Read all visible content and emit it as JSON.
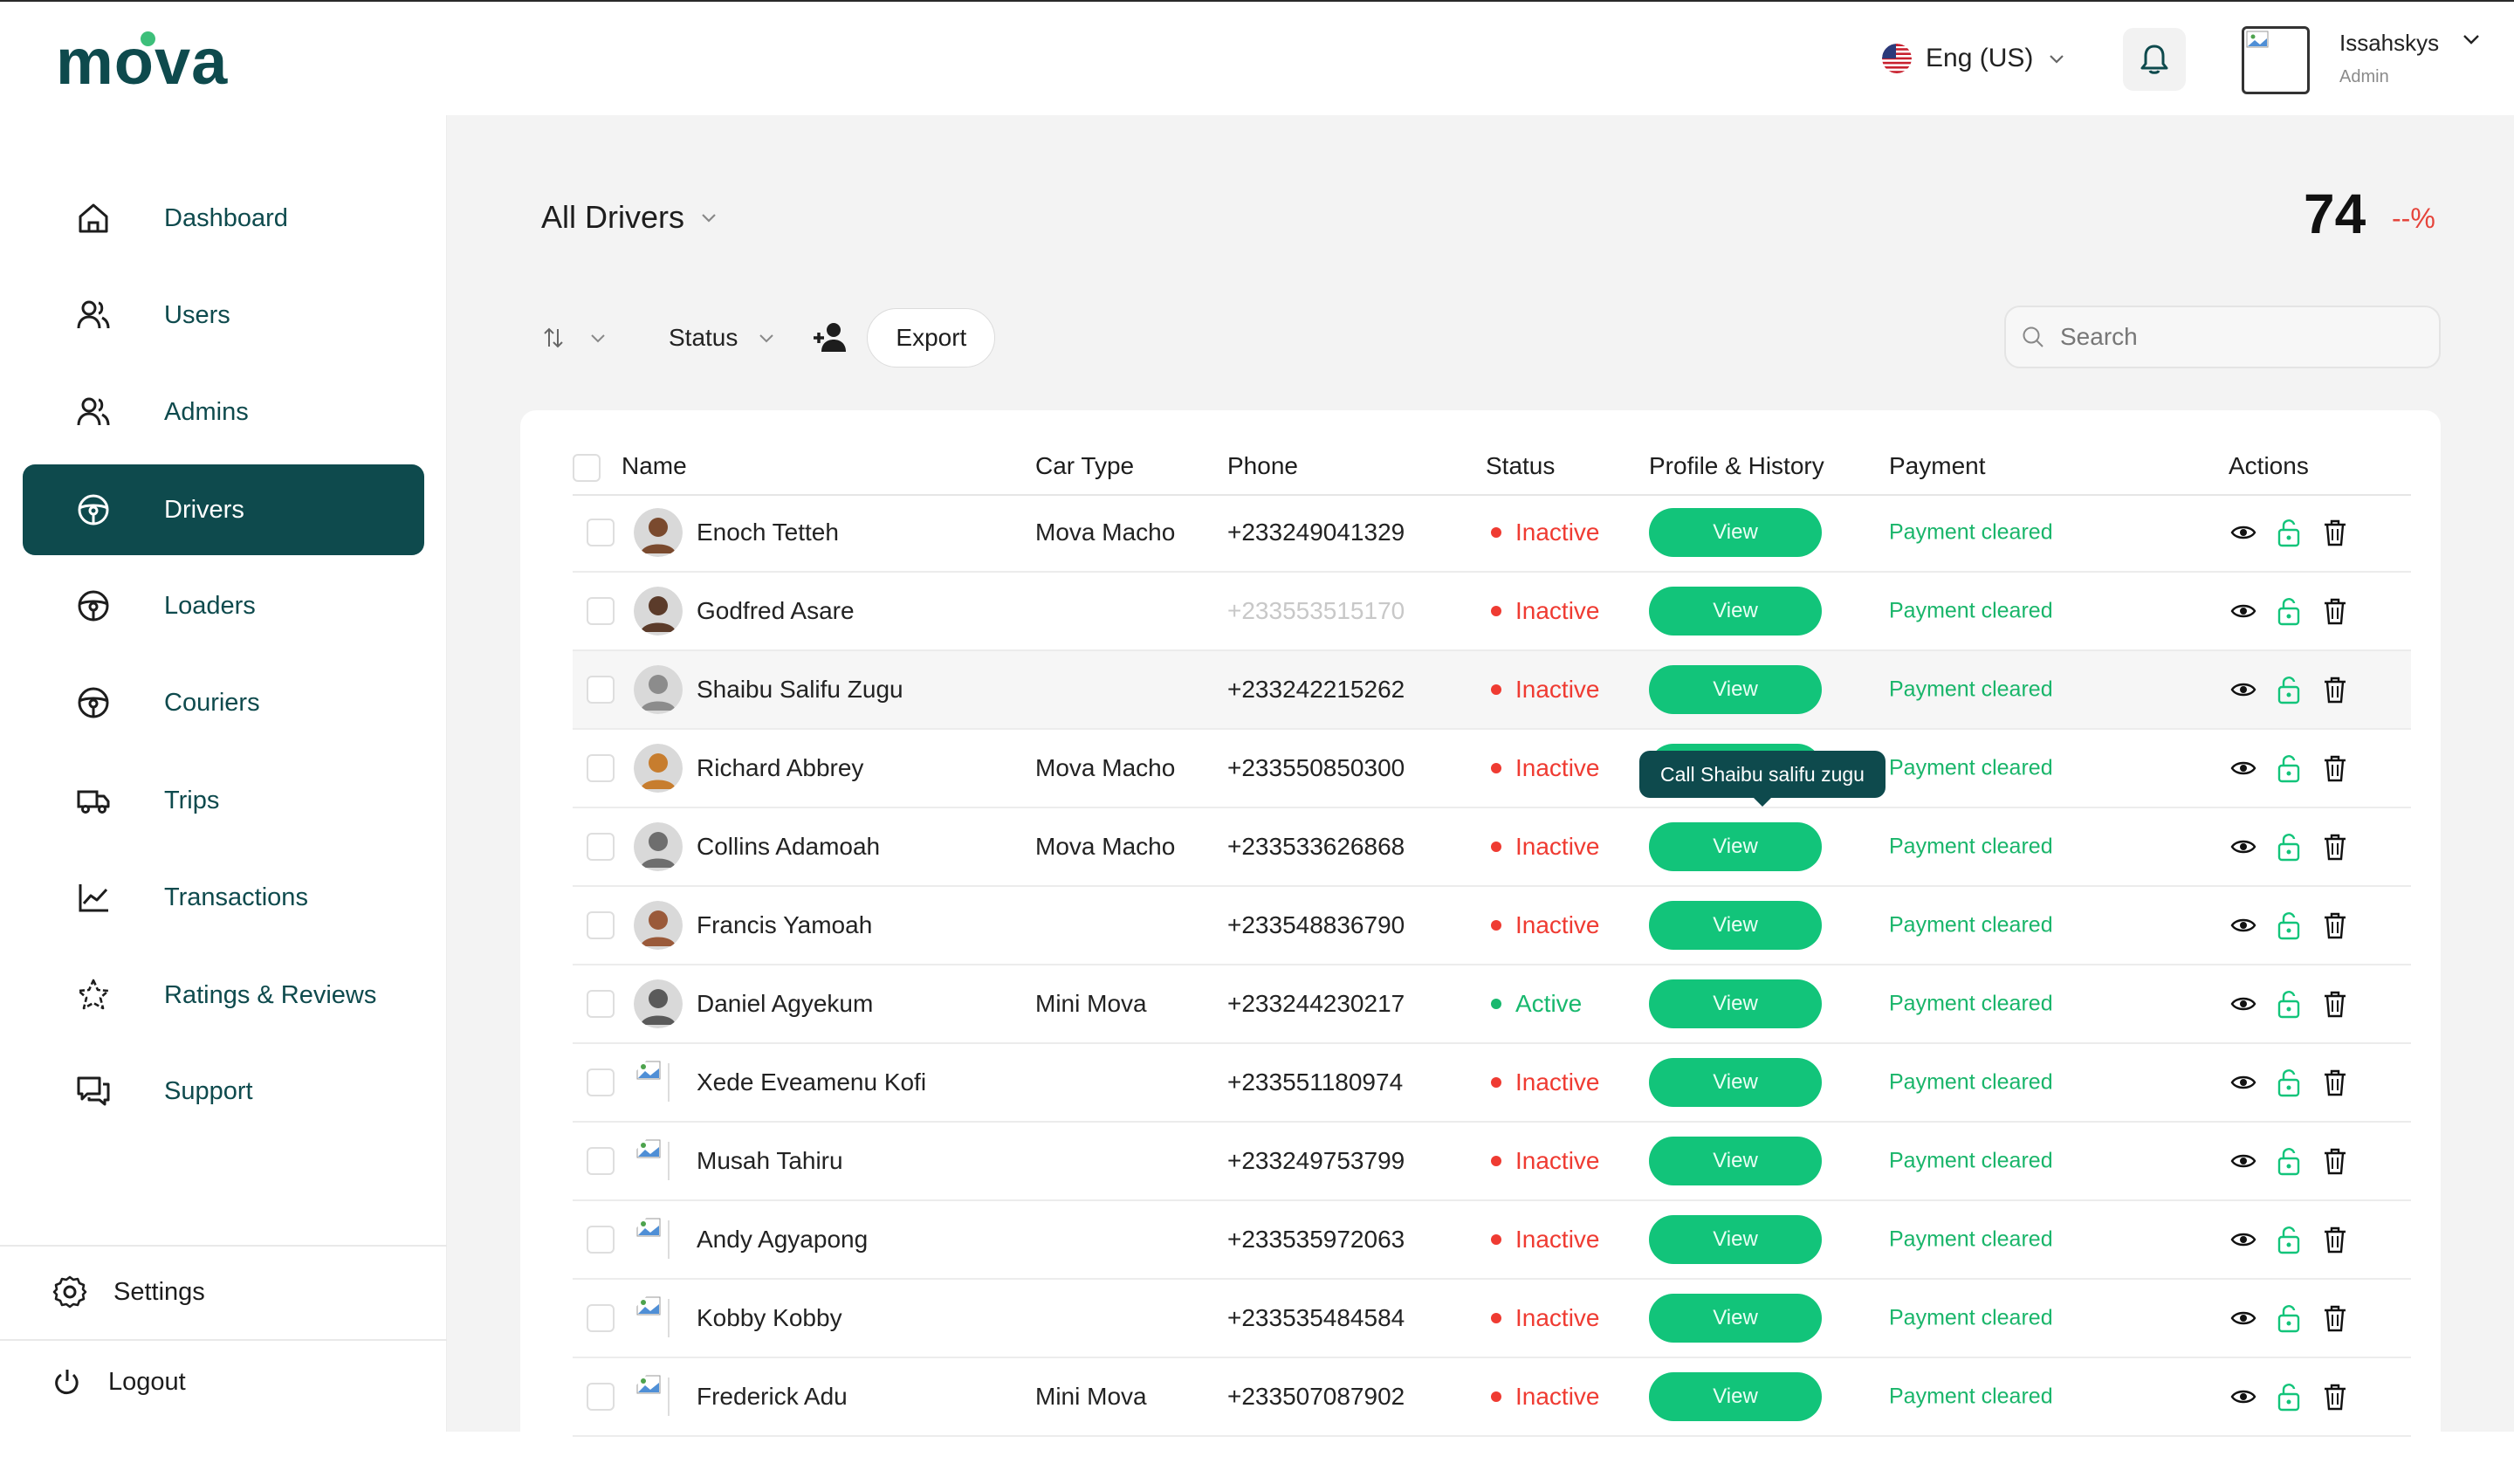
{
  "header": {
    "logo": "mova",
    "language": "Eng (US)",
    "user_name": "Issahskys",
    "user_role": "Admin"
  },
  "sidebar": {
    "items": [
      {
        "label": "Dashboard",
        "icon": "home-icon"
      },
      {
        "label": "Users",
        "icon": "users-icon"
      },
      {
        "label": "Admins",
        "icon": "admins-icon"
      },
      {
        "label": "Drivers",
        "icon": "steering-wheel-icon",
        "active": true
      },
      {
        "label": "Loaders",
        "icon": "steering-wheel-icon"
      },
      {
        "label": "Couriers",
        "icon": "steering-wheel-icon"
      },
      {
        "label": "Trips",
        "icon": "truck-icon"
      },
      {
        "label": "Transactions",
        "icon": "chart-line-icon"
      },
      {
        "label": "Ratings & Reviews",
        "icon": "star-icon"
      },
      {
        "label": "Support",
        "icon": "chat-icon"
      }
    ],
    "settings": "Settings",
    "logout": "Logout"
  },
  "main": {
    "title": "All Drivers",
    "count": "74",
    "percent": "--%",
    "status_filter": "Status",
    "export": "Export",
    "search_placeholder": "Search",
    "tooltip": "Call Shaibu salifu zugu"
  },
  "table": {
    "columns": [
      "Name",
      "Car Type",
      "Phone",
      "Status",
      "Profile & History",
      "Payment",
      "Actions"
    ],
    "view_label": "View",
    "rows": [
      {
        "name": "Enoch Tetteh",
        "car": "Mova Macho",
        "phone": "+233249041329",
        "status": "Inactive",
        "payment": "Payment cleared"
      },
      {
        "name": "Godfred Asare",
        "car": "",
        "phone": "+233553515170",
        "status": "Inactive",
        "payment": "Payment cleared"
      },
      {
        "name": "Shaibu Salifu Zugu",
        "car": "",
        "phone": "+233242215262",
        "status": "Inactive",
        "payment": "Payment cleared"
      },
      {
        "name": "Richard Abbrey",
        "car": "Mova Macho",
        "phone": "+233550850300",
        "status": "Inactive",
        "payment": "Payment cleared"
      },
      {
        "name": "Collins Adamoah",
        "car": "Mova Macho",
        "phone": "+233533626868",
        "status": "Inactive",
        "payment": "Payment cleared"
      },
      {
        "name": "Francis Yamoah",
        "car": "",
        "phone": "+233548836790",
        "status": "Inactive",
        "payment": "Payment cleared"
      },
      {
        "name": "Daniel Agyekum",
        "car": "Mini Mova",
        "phone": "+233244230217",
        "status": "Active",
        "payment": "Payment cleared"
      },
      {
        "name": "Xede Eveamenu Kofi",
        "car": "",
        "phone": "+233551180974",
        "status": "Inactive",
        "payment": "Payment cleared"
      },
      {
        "name": "Musah Tahiru",
        "car": "",
        "phone": "+233249753799",
        "status": "Inactive",
        "payment": "Payment cleared"
      },
      {
        "name": "Andy Agyapong",
        "car": "",
        "phone": "+233535972063",
        "status": "Inactive",
        "payment": "Payment cleared"
      },
      {
        "name": "Kobby Kobby",
        "car": "",
        "phone": "+233535484584",
        "status": "Inactive",
        "payment": "Payment cleared"
      },
      {
        "name": "Frederick Adu",
        "car": "Mini Mova",
        "phone": "+233507087902",
        "status": "Inactive",
        "payment": "Payment cleared"
      }
    ]
  },
  "colors": {
    "brand": "#0e4a4d",
    "accent_green": "#12c47a",
    "inactive_red": "#ef3b32",
    "active_green": "#18b86e"
  }
}
